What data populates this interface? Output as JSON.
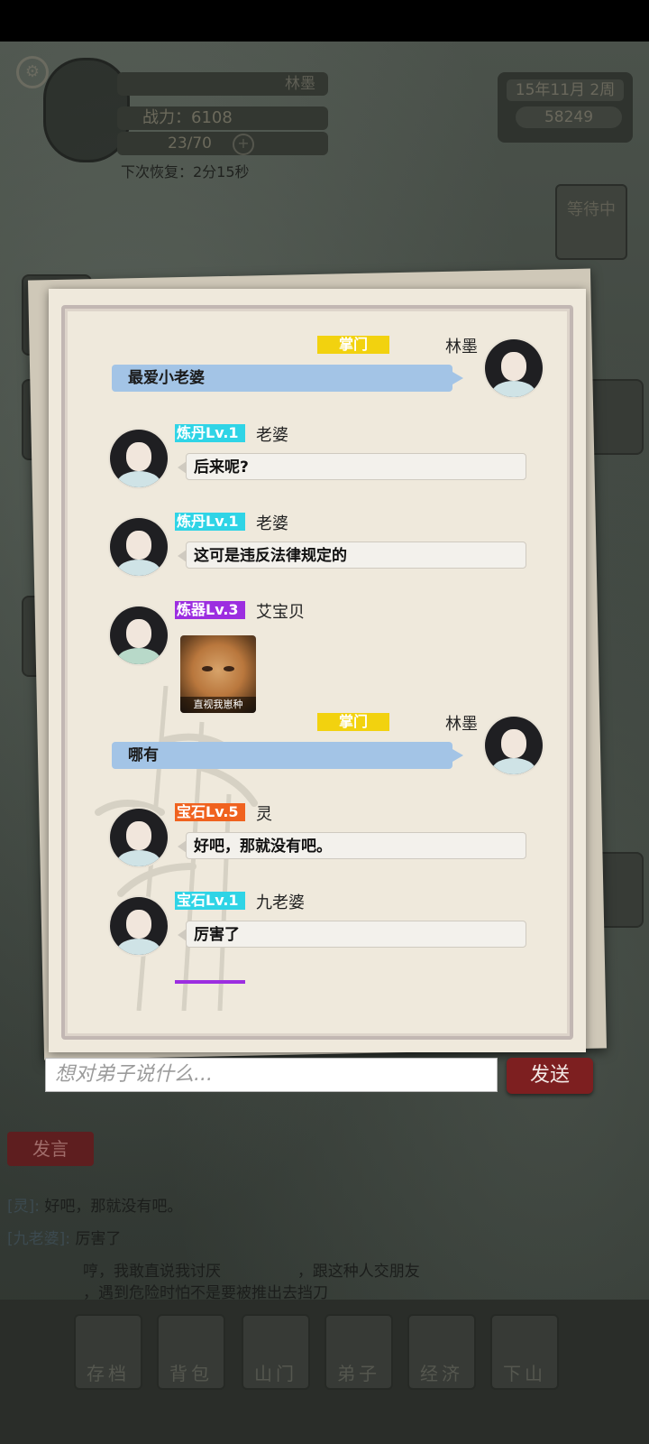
{
  "hud": {
    "player_name": "林墨",
    "power_label": "战力：6108",
    "energy": "23/70",
    "recover_text": "下次恢复：2分15秒",
    "date": "15年11月 2周",
    "gems": "58249",
    "waiting_label": "等待中"
  },
  "chat": {
    "messages": [
      {
        "self": true,
        "badge": "掌门",
        "name": "林墨",
        "text": "最爱小老婆"
      },
      {
        "self": false,
        "badge": "炼丹Lv.1",
        "badge_color": "#2fd4e6",
        "name": "老婆",
        "text": "后来呢?"
      },
      {
        "self": false,
        "badge": "炼丹Lv.1",
        "badge_color": "#2fd4e6",
        "name": "老婆",
        "text": "这可是违反法律规定的"
      },
      {
        "self": false,
        "badge": "炼器Lv.3",
        "badge_color": "#9c2ee0",
        "name": "艾宝贝",
        "sticker_caption": "直视我崽种"
      },
      {
        "self": true,
        "badge": "掌门",
        "name": "林墨",
        "text": "哪有"
      },
      {
        "self": false,
        "badge": "宝石Lv.5",
        "badge_color": "#f0621f",
        "name": "灵",
        "text": "好吧，那就没有吧。"
      },
      {
        "self": false,
        "badge": "宝石Lv.1",
        "badge_color": "#2fd4e6",
        "name": "九老婆",
        "text": "厉害了"
      }
    ],
    "input_placeholder": "想对弟子说什么...",
    "send_label": "发送"
  },
  "lower": {
    "speak_label": "发言",
    "log": [
      {
        "who": "[灵]:",
        "text": "好吧，那就没有吧。"
      },
      {
        "who": "[九老婆]:",
        "text": "厉害了"
      },
      {
        "who": "",
        "text": "哼，我敢直说我讨厌",
        "text2": "，跟这种人交朋友"
      },
      {
        "who": "",
        "text": "，遇到危险时怕不是要被推出去挡刀"
      }
    ],
    "nav": [
      "存档",
      "背包",
      "山门",
      "弟子",
      "经济",
      "下山"
    ]
  }
}
